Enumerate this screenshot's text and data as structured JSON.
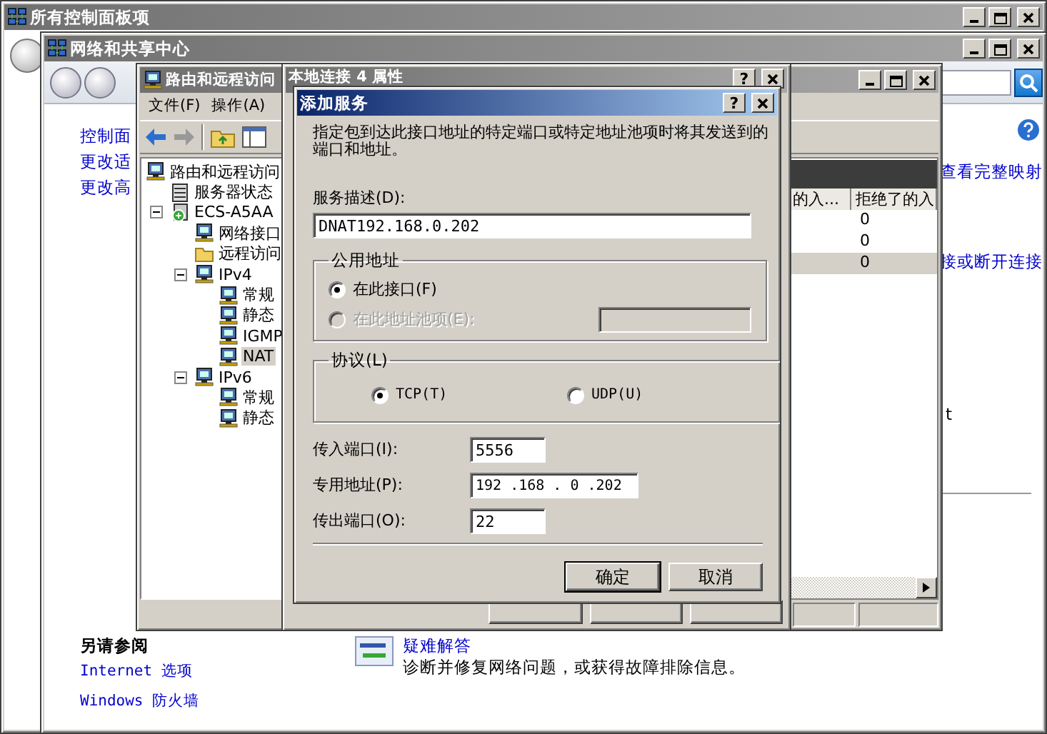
{
  "control_panel": {
    "title": "所有控制面板项",
    "active": false
  },
  "network_center": {
    "title": "网络和共享中心",
    "active": false,
    "sidebar_links": [
      "控制面",
      "更改适",
      "更改高"
    ],
    "right_links": [
      "查看完整映射",
      "接或断开连接"
    ],
    "right_fragment": "t",
    "see_also": {
      "heading": "另请参阅",
      "links": [
        "Internet 选项",
        "Windows 防火墙"
      ]
    },
    "troubleshoot": {
      "title": "疑难解答",
      "description": "诊断并修复网络问题，或获得故障排除信息。"
    }
  },
  "routing": {
    "title": "路由和远程访问",
    "active": false,
    "menu": [
      "文件(F)",
      "操作(A)"
    ],
    "tree": [
      {
        "label": "路由和远程访问",
        "kind": "computer",
        "selected": false,
        "children": [
          {
            "label": "服务器状态",
            "kind": "server",
            "selected": false
          },
          {
            "label": "ECS-A5AA",
            "kind": "host",
            "selected": false,
            "expanded": true,
            "children": [
              {
                "label": "网络接口",
                "kind": "computer",
                "selected": false
              },
              {
                "label": "远程访问",
                "kind": "folder",
                "selected": false
              },
              {
                "label": "IPv4",
                "kind": "computer",
                "selected": false,
                "expanded": true,
                "children": [
                  {
                    "label": "常规",
                    "kind": "computer",
                    "selected": false
                  },
                  {
                    "label": "静态",
                    "kind": "computer",
                    "selected": false
                  },
                  {
                    "label": "IGMP",
                    "kind": "computer",
                    "selected": false
                  },
                  {
                    "label": "NAT",
                    "kind": "computer",
                    "selected": true
                  }
                ]
              },
              {
                "label": "IPv6",
                "kind": "computer",
                "selected": false,
                "expanded": true,
                "children": [
                  {
                    "label": "常规",
                    "kind": "computer",
                    "selected": false
                  },
                  {
                    "label": "静态",
                    "kind": "computer",
                    "selected": false
                  }
                ]
              }
            ]
          }
        ]
      }
    ],
    "columns": [
      "的入...",
      "拒绝了的入"
    ],
    "rows": [
      {
        "values": [
          "0"
        ],
        "selected": false
      },
      {
        "values": [
          "0"
        ],
        "selected": false
      },
      {
        "values": [
          "0"
        ],
        "selected": true
      }
    ]
  },
  "properties": {
    "title": "本地连接 4 属性",
    "active": false,
    "help": "?"
  },
  "add_service": {
    "title": "添加服务",
    "active": true,
    "help": "?",
    "description": "指定包到达此接口地址的特定端口或特定地址池项时将其发送到的端口和地址。",
    "service_label": "服务描述(D):",
    "service_value": "DNAT192.168.0.202",
    "public_address": {
      "legend": "公用地址",
      "options": [
        {
          "label": "在此接口(F)",
          "selected": true,
          "disabled": false
        },
        {
          "label": "在此地址池项(E):",
          "selected": false,
          "disabled": true
        }
      ]
    },
    "protocol": {
      "legend": "协议(L)",
      "options": [
        {
          "label": "TCP(T)",
          "selected": true
        },
        {
          "label": "UDP(U)",
          "selected": false
        }
      ]
    },
    "fields": [
      {
        "label": "传入端口(I):",
        "value": "5556",
        "kind": "port"
      },
      {
        "label": "专用地址(P):",
        "value": "192 .168 . 0 .202",
        "kind": "address"
      },
      {
        "label": "传出端口(O):",
        "value": "22",
        "kind": "port"
      }
    ],
    "buttons": [
      {
        "label": "确定",
        "default": true
      },
      {
        "label": "取消",
        "default": false
      }
    ]
  }
}
